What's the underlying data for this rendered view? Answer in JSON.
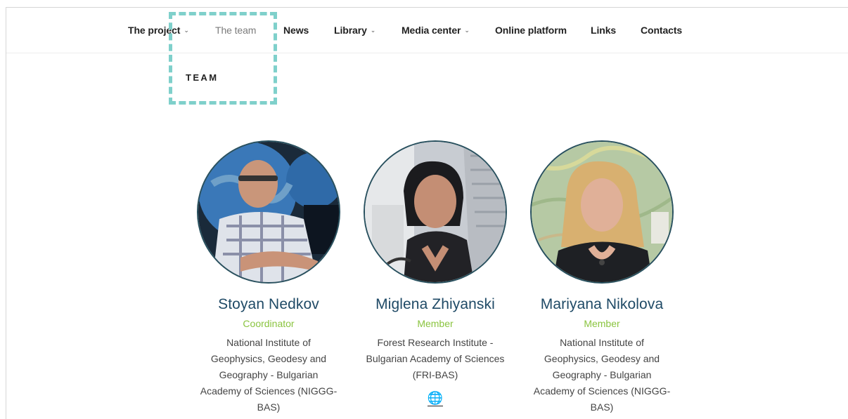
{
  "nav": {
    "items": [
      {
        "label": "The project",
        "caret": true
      },
      {
        "label": "The team",
        "caret": false
      },
      {
        "label": "News",
        "caret": false
      },
      {
        "label": "Library",
        "caret": true
      },
      {
        "label": "Media center",
        "caret": true
      },
      {
        "label": "Online platform",
        "caret": false
      },
      {
        "label": "Links",
        "caret": false
      },
      {
        "label": "Contacts",
        "caret": false
      }
    ],
    "caret_glyph": "⌄"
  },
  "section": {
    "title": "TEAM"
  },
  "members": [
    {
      "name": "Stoyan Nedkov",
      "role": "Coordinator",
      "org": "National Institute of Geophysics, Geodesy and Geography - Bulgarian Academy of Sciences (NIGGG-BAS)",
      "icon": "person-photo"
    },
    {
      "name": "Miglena Zhiyanski",
      "role": "Member",
      "org": "Forest Research Institute - Bulgarian Academy of Sciences (FRI-BAS)",
      "icon": "person-photo",
      "link_icon": "🌐"
    },
    {
      "name": "Mariyana Nikolova",
      "role": "Member",
      "org": "National Institute of Geophysics, Geodesy and Geography - Bulgarian Academy of Sciences (NIGGG-BAS)",
      "icon": "person-photo"
    }
  ],
  "colors": {
    "highlight": "#7fd0cb",
    "name": "#1f4a66",
    "role": "#8ac43f",
    "avatar_border": "#28505e"
  }
}
